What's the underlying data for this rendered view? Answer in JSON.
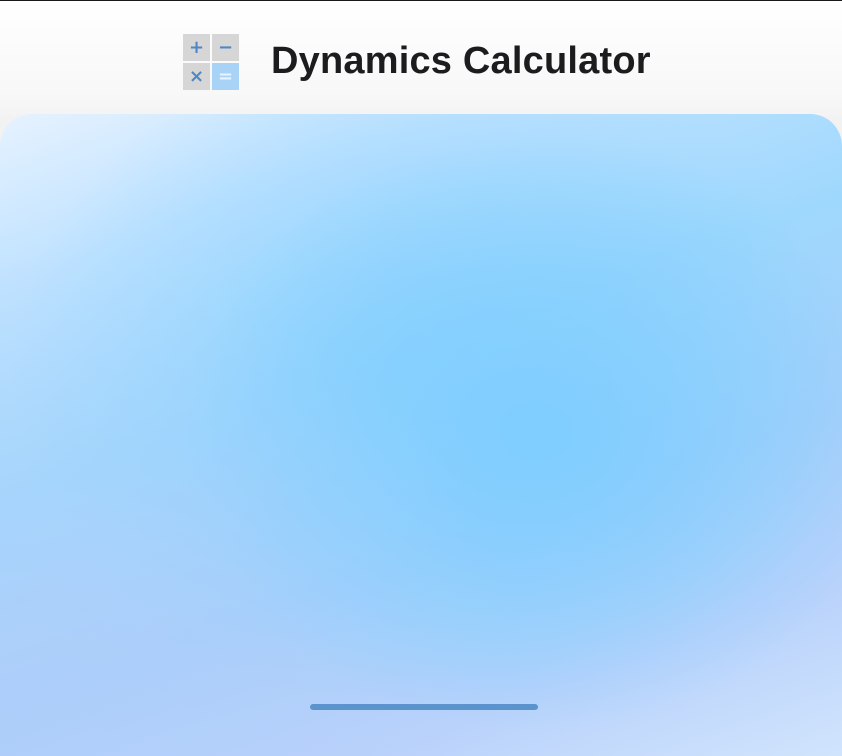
{
  "header": {
    "title": "Dynamics Calculator",
    "icon": {
      "name": "calculator-icon",
      "cells": [
        {
          "symbol": "+",
          "name": "plus-icon"
        },
        {
          "symbol": "−",
          "name": "minus-icon"
        },
        {
          "symbol": "×",
          "name": "multiply-icon"
        },
        {
          "symbol": "=",
          "name": "equals-icon"
        }
      ]
    }
  },
  "colors": {
    "title_text": "#1c1c1e",
    "icon_cell": "#d6d6d6",
    "icon_glyph": "#4f86c6",
    "icon_equals_cell": "#a9d2f7",
    "panel_primary": "#8fd3ff",
    "home_indicator": "#5b94cc"
  }
}
